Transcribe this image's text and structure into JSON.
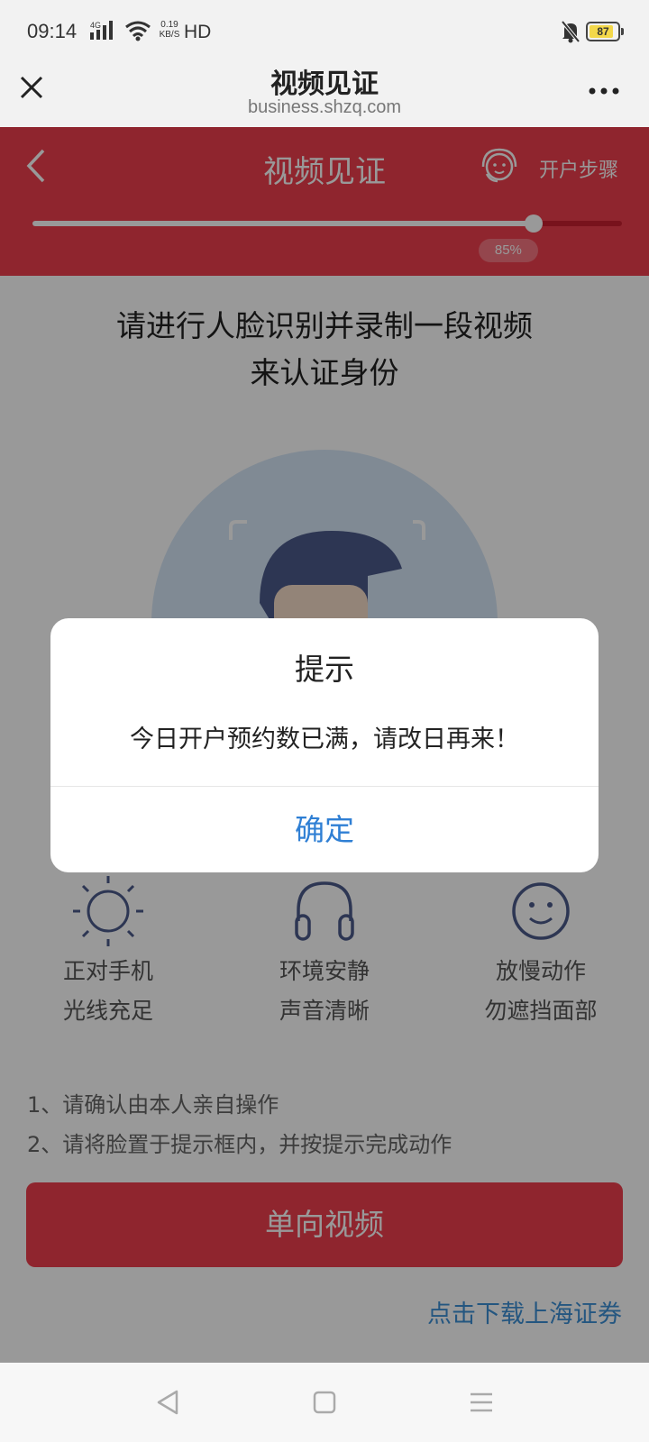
{
  "status_bar": {
    "time": "09:14",
    "network": "4G",
    "speed_value": "0.19",
    "speed_unit": "KB/S",
    "hd": "HD",
    "battery": "87",
    "battery_level": 0.87
  },
  "browser": {
    "title": "视频见证",
    "url": "business.shzq.com"
  },
  "app_header": {
    "title": "视频见证",
    "steps_label": "开户步骤",
    "progress_label": "85%",
    "progress_fraction": 0.85
  },
  "main": {
    "instruction_line1": "请进行人脸识别并录制一段视频",
    "instruction_line2": "来认证身份",
    "tips": [
      {
        "icon": "sun-icon",
        "line1": "正对手机",
        "line2": "光线充足"
      },
      {
        "icon": "headphones-icon",
        "line1": "环境安静",
        "line2": "声音清晰"
      },
      {
        "icon": "smile-icon",
        "line1": "放慢动作",
        "line2": "勿遮挡面部"
      }
    ],
    "notes": [
      "1、请确认由本人亲自操作",
      "2、请将脸置于提示框内，并按提示完成动作"
    ],
    "primary_button": "单向视频",
    "download_link": "点击下载上海证券"
  },
  "dialog": {
    "title": "提示",
    "message": "今日开户预约数已满，请改日再来！",
    "confirm": "确定"
  },
  "colors": {
    "brand_red": "#ee3f4d",
    "link_blue": "#3d8fd6",
    "confirm_blue": "#2f7fd4"
  }
}
